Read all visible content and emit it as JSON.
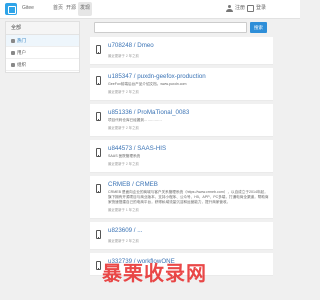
{
  "nav": {
    "brand": "Gitee",
    "items": [
      "首页",
      "开源",
      "发现"
    ],
    "user_label": "注册",
    "login_label": "登录"
  },
  "sidebar": {
    "header": "全部",
    "items": [
      {
        "label": "热门"
      },
      {
        "label": "用户"
      },
      {
        "label": "组织"
      }
    ]
  },
  "search": {
    "placeholder": "",
    "button": "搜索"
  },
  "results": [
    {
      "title": "u708248 / Dmeo",
      "desc": "",
      "meta": "最近更新于 2 年之前"
    },
    {
      "title": "u185347 / puxdn-geefox-production",
      "desc": "GeeFox前端后台产品介绍文档。www.puxdn.com",
      "meta": "最近更新于 2 年之前"
    },
    {
      "title": "u851336 / ProMaTional_0083",
      "desc": "项目代码仓库已经搬到……………",
      "meta": "最近更新于 2 年之前"
    },
    {
      "title": "u844573 / SAAS-HIS",
      "desc": "SAAS 医院管理系统",
      "meta": "最近更新于 2 年之前"
    },
    {
      "title": "CRMEB / CRMEB",
      "desc": "CRMEB 是面向企业的商城与客户关系管理系统（https://www.crmeb.com），以自成立于2014年起，旗下拥有开源项目与商业版本，支持小程序、公众号、H5、APP、PC多端，打通电商全渠道，帮助商家快速搭建自己的电商平台，获得私域流量沉淀和运营能力，提升商家营收。",
      "meta": "最近更新于 1 年之前"
    },
    {
      "title": "u823609 / ...",
      "desc": "",
      "meta": "最近更新于 2 年之前"
    },
    {
      "title": "u332739 / workflowONE",
      "desc": "",
      "meta": ""
    }
  ],
  "watermark": "暴栗收录网"
}
